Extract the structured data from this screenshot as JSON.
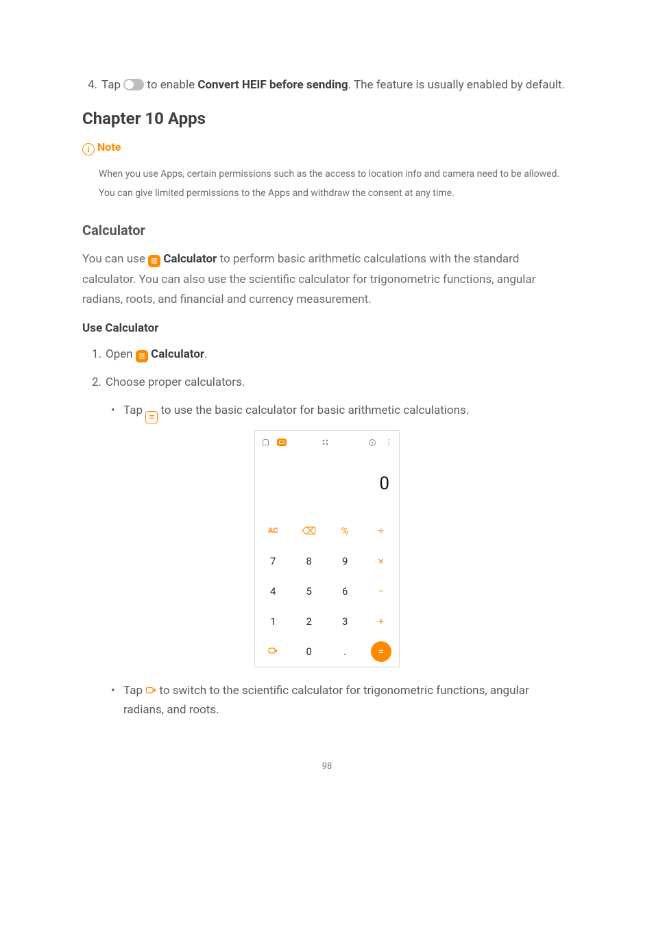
{
  "step4": {
    "num": "4.",
    "pre": "Tap ",
    "mid": " to enable ",
    "bold": "Convert HEIF before sending",
    "post": ". The feature is usually enabled by default."
  },
  "chapter": "Chapter 10 Apps",
  "note": {
    "label": "Note",
    "body": "When you use Apps, certain permissions such as the access to location info and camera need to be allowed. You can give limited permissions to the Apps and withdraw the consent at any time."
  },
  "calc_section": {
    "title": "Calculator",
    "para_pre": "You can use ",
    "para_app": "Calculator",
    "para_post": " to perform basic arithmetic calculations with the standard calculator. You can also use the scientific calculator for trigonometric functions, angular radians, roots, and financial and currency measurement.",
    "use_title": "Use Calculator",
    "step1": {
      "num": "1.",
      "pre": "Open ",
      "app": "Calculator",
      "post": "."
    },
    "step2": {
      "num": "2.",
      "text": "Choose proper calculators."
    },
    "bullet1": {
      "pre": "Tap ",
      "post": " to use the basic calculator for basic arithmetic calculations."
    },
    "bullet2": {
      "pre": "Tap ",
      "post": " to switch to the scientific calculator for trigonometric functions, angular radians, and roots."
    }
  },
  "calc_ui": {
    "display": "0",
    "row1": [
      "AC",
      "⌫",
      "%",
      "÷"
    ],
    "row2": [
      "7",
      "8",
      "9",
      "×"
    ],
    "row3": [
      "4",
      "5",
      "6",
      "−"
    ],
    "row4": [
      "1",
      "2",
      "3",
      "+"
    ],
    "row5_spicon": "⇄",
    "row5": [
      "0",
      "."
    ],
    "eq": "="
  },
  "page_number": "98"
}
